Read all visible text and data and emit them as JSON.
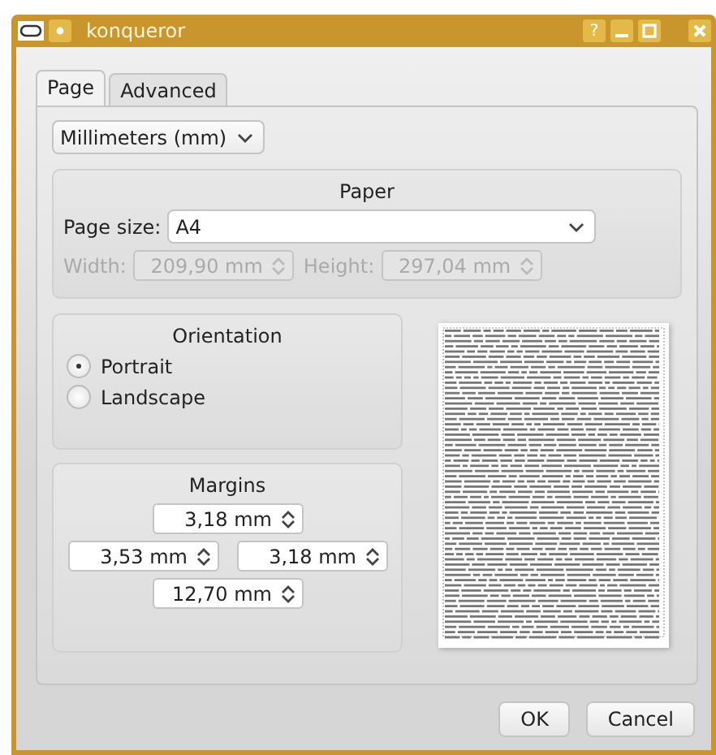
{
  "window": {
    "title": "konqueror",
    "buttons": [
      {
        "kind": "help",
        "label": "?"
      },
      {
        "kind": "minimize"
      },
      {
        "kind": "maximize"
      },
      {
        "kind": "close"
      }
    ]
  },
  "tabs": [
    {
      "label": "Page",
      "selected": true
    },
    {
      "label": "Advanced",
      "selected": false
    }
  ],
  "unit_select": {
    "value": "Millimeters (mm)"
  },
  "paper": {
    "title": "Paper",
    "page_size": {
      "label": "Page size:",
      "value": "A4"
    },
    "width": {
      "label": "Width:",
      "value": "209,90 mm",
      "disabled": true
    },
    "height": {
      "label": "Height:",
      "value": "297,04 mm",
      "disabled": true
    }
  },
  "orientation": {
    "title": "Orientation",
    "options": [
      {
        "label": "Portrait",
        "selected": true
      },
      {
        "label": "Landscape",
        "selected": false
      }
    ]
  },
  "margins": {
    "title": "Margins",
    "top": "3,18 mm",
    "left": "3,53 mm",
    "right": "3,18 mm",
    "bottom": "12,70 mm"
  },
  "buttons": [
    {
      "label": "OK"
    },
    {
      "label": "Cancel"
    }
  ]
}
